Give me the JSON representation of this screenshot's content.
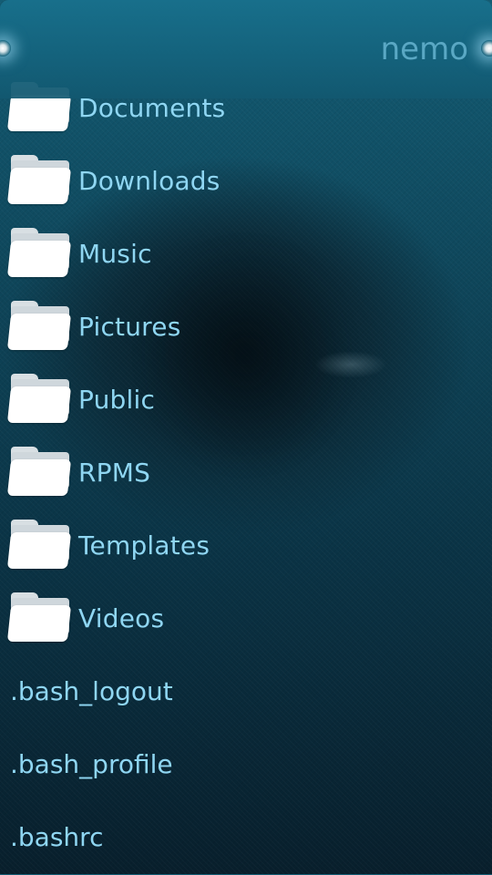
{
  "header": {
    "title": "nemo"
  },
  "folders": [
    {
      "name": "Documents",
      "icon": "folder-icon"
    },
    {
      "name": "Downloads",
      "icon": "folder-icon"
    },
    {
      "name": "Music",
      "icon": "folder-icon"
    },
    {
      "name": "Pictures",
      "icon": "folder-icon"
    },
    {
      "name": "Public",
      "icon": "folder-icon"
    },
    {
      "name": "RPMS",
      "icon": "folder-icon"
    },
    {
      "name": "Templates",
      "icon": "folder-icon"
    },
    {
      "name": "Videos",
      "icon": "folder-icon"
    }
  ],
  "files": [
    {
      "name": ".bash_logout"
    },
    {
      "name": ".bash_profile"
    },
    {
      "name": ".bashrc"
    }
  ],
  "colors": {
    "accent_text": "#8fd6f2",
    "header_title": "#5aa8c4",
    "header_bg": "#14627c"
  }
}
